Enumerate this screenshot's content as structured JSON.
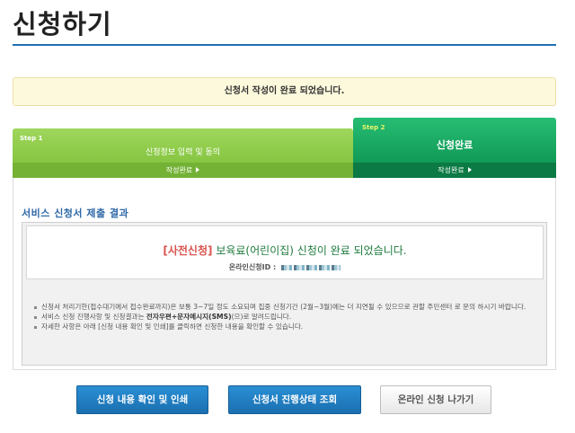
{
  "page": {
    "title": "신청하기"
  },
  "notice": {
    "text": "신청서 작성이 완료 되었습니다."
  },
  "steps": [
    {
      "num": "Step 1",
      "title": "신청정보 입력 및 동의",
      "status": "작성완료"
    },
    {
      "num": "Step 2",
      "title": "신청완료",
      "status": "작성완료"
    }
  ],
  "result": {
    "section_title": "서비스 신청서 제출 결과",
    "tag": "[사전신청]",
    "message": " 보육료(어린이집) 신청이 완료 되었습니다.",
    "id_label": "온라인신청ID :"
  },
  "info": [
    "신청서 처리기한(접수대기에서 접수완료까지)은 보통 3~7일 정도 소요되며 집중 신청기간 (2월~3월)에는 더 지연될 수 있으므로 관할 주민센터 로 문의 하시기 바랍니다.",
    "자세한 사항은 아래 [신청 내용 확인 및 인쇄]를 클릭하면 신청한 내용을 확인할 수 있습니다."
  ],
  "info_sms": {
    "before": "서비스 신청 진행사항 및 신청결과는 ",
    "bold": "전자우편+문자메시지(SMS)",
    "after": "(으)로 알려드립니다."
  },
  "buttons": {
    "print": "신청 내용 확인 및 인쇄",
    "status": "신청서 진행상태 조회",
    "exit": "온라인 신청 나가기"
  }
}
